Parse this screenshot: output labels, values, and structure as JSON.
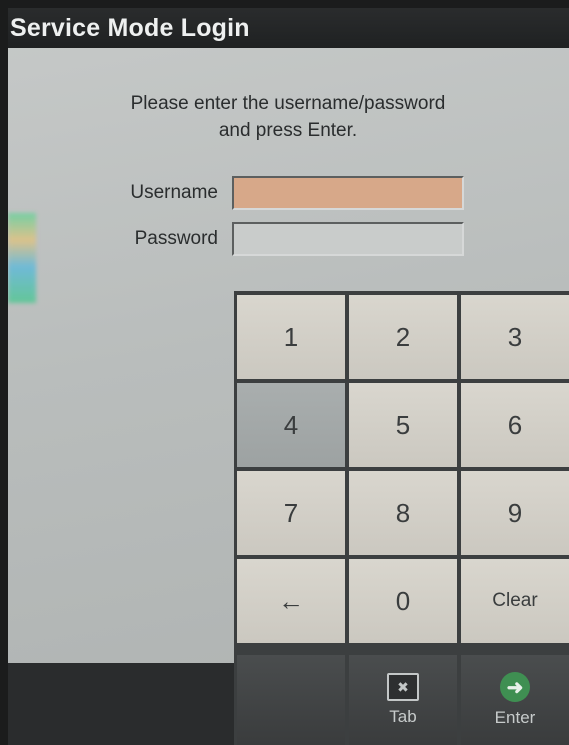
{
  "window": {
    "title": "Service Mode Login"
  },
  "instructions": {
    "line1": "Please enter the username/password",
    "line2": "and press Enter."
  },
  "form": {
    "username_label": "Username",
    "username_value": "",
    "password_label": "Password",
    "password_value": ""
  },
  "keypad": {
    "keys": [
      "1",
      "2",
      "3",
      "4",
      "5",
      "6",
      "7",
      "8",
      "9",
      "←",
      "0",
      "Clear"
    ],
    "tab_label": "Tab",
    "enter_label": "Enter",
    "tab_icon": "tab-icon",
    "enter_icon": "arrow-right-circle-icon"
  },
  "colors": {
    "titlebar": "#1f2122",
    "active_field": "#d7a889",
    "inactive_field": "#c9cccb",
    "key": "#d9d6ce",
    "pressed_key": "#a9aeae",
    "enter_icon": "#3f8f52"
  }
}
